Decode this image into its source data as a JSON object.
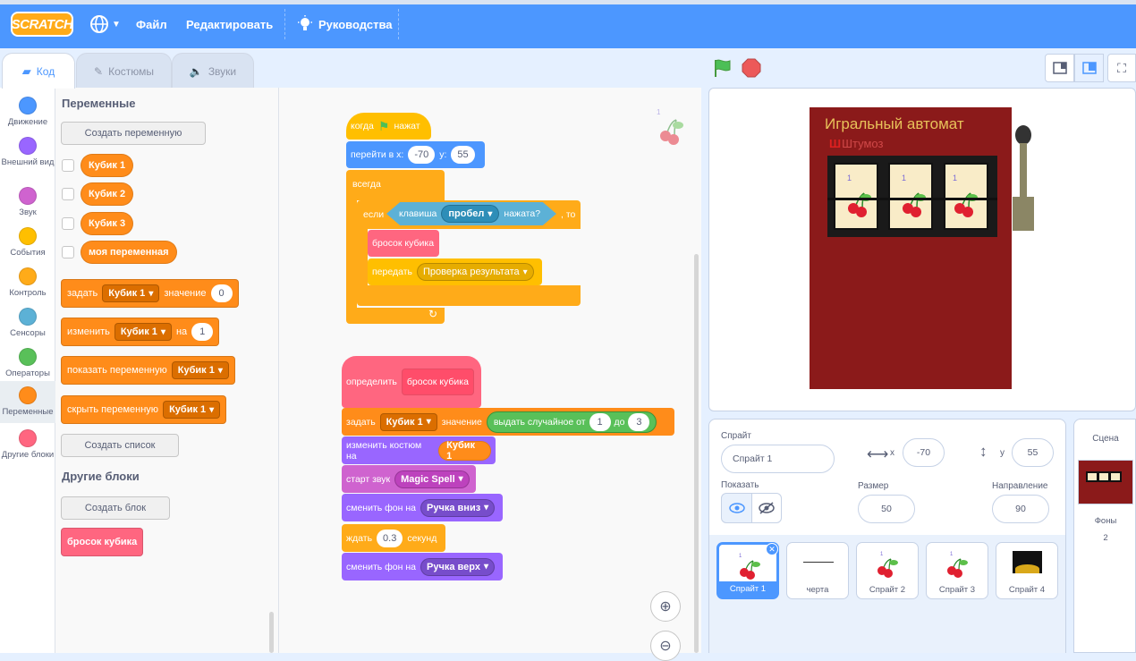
{
  "topbar": {
    "logo": "SCRATCH",
    "menu_file": "Файл",
    "menu_edit": "Редактировать",
    "menu_tutorials": "Руководства"
  },
  "tabs": [
    {
      "label": "Код"
    },
    {
      "label": "Костюмы"
    },
    {
      "label": "Звуки"
    }
  ],
  "categories": [
    {
      "label": "Движение",
      "color": "#4c97ff"
    },
    {
      "label": "Внешний вид",
      "color": "#9966ff"
    },
    {
      "label": "Звук",
      "color": "#cf63cf"
    },
    {
      "label": "События",
      "color": "#ffbf00"
    },
    {
      "label": "Контроль",
      "color": "#ffab19"
    },
    {
      "label": "Сенсоры",
      "color": "#5cb1d6"
    },
    {
      "label": "Операторы",
      "color": "#59c059"
    },
    {
      "label": "Переменные",
      "color": "#ff8c1a"
    },
    {
      "label": "Другие блоки",
      "color": "#ff6680"
    }
  ],
  "palette": {
    "variables_heading": "Переменные",
    "create_variable": "Создать переменную",
    "variables": [
      "Кубик 1",
      "Кубик 2",
      "Кубик 3",
      "моя переменная"
    ],
    "set_block": {
      "word": "задать",
      "var": "Кубик 1",
      "word2": "значение",
      "value": "0"
    },
    "change_block": {
      "word": "изменить",
      "var": "Кубик 1",
      "word2": "на",
      "value": "1"
    },
    "show_block": {
      "word": "показать переменную",
      "var": "Кубик 1"
    },
    "hide_block": {
      "word": "скрыть переменную",
      "var": "Кубик 1"
    },
    "create_list": "Создать список",
    "other_heading": "Другие блоки",
    "create_block": "Создать блок",
    "custom_block": "бросок кубика"
  },
  "script1": {
    "hat": "когда",
    "hat2": "нажат",
    "goto": "перейти в x:",
    "goto_x": "-70",
    "goto_y_label": "y:",
    "goto_y": "55",
    "forever": "всегда",
    "if": "если",
    "key_pressed": "клавиша",
    "key": "пробел",
    "pressed": "нажата?",
    "then": ", то",
    "call": "бросок кубика",
    "broadcast": "передать",
    "broadcast_msg": "Проверка результата"
  },
  "script2": {
    "define": "определить",
    "define_name": "бросок кубика",
    "set": "задать",
    "set_var": "Кубик 1",
    "set_word": "значение",
    "random": "выдать случайное от",
    "random_from": "1",
    "random_to_label": "до",
    "random_to": "3",
    "costume": "изменить костюм на",
    "costume_var": "Кубик 1",
    "sound": "старт звук",
    "sound_name": "Magic Spell",
    "backdrop1": "сменить фон на",
    "backdrop1_name": "Ручка вниз",
    "wait": "ждать",
    "wait_val": "0.3",
    "wait_unit": "секунд",
    "backdrop2": "сменить фон на",
    "backdrop2_name": "Ручка верх"
  },
  "stage": {
    "title": "Игральный автомат",
    "author": "Штумоз",
    "reel_digit": "1"
  },
  "sprite_info": {
    "sprite_label": "Спрайт",
    "sprite_name": "Спрайт 1",
    "x_label": "x",
    "x_value": "-70",
    "y_label": "y",
    "y_value": "55",
    "show_label": "Показать",
    "size_label": "Размер",
    "size_value": "50",
    "direction_label": "Направление",
    "direction_value": "90"
  },
  "sprites": [
    {
      "name": "Спрайт 1",
      "icon": "cherry-icon"
    },
    {
      "name": "черта",
      "icon": "line-icon"
    },
    {
      "name": "Спрайт 2",
      "icon": "cherry-icon"
    },
    {
      "name": "Спрайт 3",
      "icon": "cherry-icon"
    },
    {
      "name": "Спрайт 4",
      "icon": "coins-icon"
    }
  ],
  "scene": {
    "title": "Сцена",
    "backdrops_label": "Фоны",
    "backdrops_count": "2"
  }
}
